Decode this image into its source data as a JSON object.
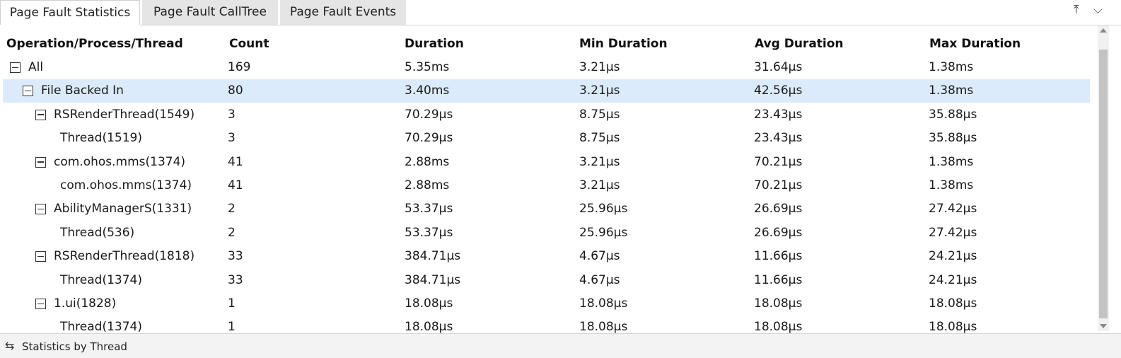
{
  "tabs": [
    {
      "label": "Page Fault Statistics",
      "active": true
    },
    {
      "label": "Page Fault CallTree",
      "active": false
    },
    {
      "label": "Page Fault Events",
      "active": false
    }
  ],
  "window_controls": {
    "pin_icon": "⤒",
    "collapse_icon": "⌵"
  },
  "columns": [
    "Operation/Process/Thread",
    "Count",
    "Duration",
    "Min Duration",
    "Avg Duration",
    "Max Duration"
  ],
  "rows": [
    {
      "name": "All",
      "level": 0,
      "expandable": true,
      "selected": false,
      "count": "169",
      "duration": "5.35ms",
      "min": "3.21μs",
      "avg": "31.64μs",
      "max": "1.38ms"
    },
    {
      "name": "File Backed In",
      "level": 1,
      "expandable": true,
      "selected": true,
      "count": "80",
      "duration": "3.40ms",
      "min": "3.21μs",
      "avg": "42.56μs",
      "max": "1.38ms"
    },
    {
      "name": "RSRenderThread(1549)",
      "level": 2,
      "expandable": true,
      "selected": false,
      "count": "3",
      "duration": "70.29μs",
      "min": "8.75μs",
      "avg": "23.43μs",
      "max": "35.88μs"
    },
    {
      "name": "Thread(1519)",
      "level": 3,
      "expandable": false,
      "selected": false,
      "count": "3",
      "duration": "70.29μs",
      "min": "8.75μs",
      "avg": "23.43μs",
      "max": "35.88μs"
    },
    {
      "name": "com.ohos.mms(1374)",
      "level": 2,
      "expandable": true,
      "selected": false,
      "count": "41",
      "duration": "2.88ms",
      "min": "3.21μs",
      "avg": "70.21μs",
      "max": "1.38ms"
    },
    {
      "name": "com.ohos.mms(1374)",
      "level": 3,
      "expandable": false,
      "selected": false,
      "count": "41",
      "duration": "2.88ms",
      "min": "3.21μs",
      "avg": "70.21μs",
      "max": "1.38ms"
    },
    {
      "name": "AbilityManagerS(1331)",
      "level": 2,
      "expandable": true,
      "selected": false,
      "count": "2",
      "duration": "53.37μs",
      "min": "25.96μs",
      "avg": "26.69μs",
      "max": "27.42μs"
    },
    {
      "name": "Thread(536)",
      "level": 3,
      "expandable": false,
      "selected": false,
      "count": "2",
      "duration": "53.37μs",
      "min": "25.96μs",
      "avg": "26.69μs",
      "max": "27.42μs"
    },
    {
      "name": "RSRenderThread(1818)",
      "level": 2,
      "expandable": true,
      "selected": false,
      "count": "33",
      "duration": "384.71μs",
      "min": "4.67μs",
      "avg": "11.66μs",
      "max": "24.21μs"
    },
    {
      "name": "Thread(1374)",
      "level": 3,
      "expandable": false,
      "selected": false,
      "count": "33",
      "duration": "384.71μs",
      "min": "4.67μs",
      "avg": "11.66μs",
      "max": "24.21μs"
    },
    {
      "name": "1.ui(1828)",
      "level": 2,
      "expandable": true,
      "selected": false,
      "count": "1",
      "duration": "18.08μs",
      "min": "18.08μs",
      "avg": "18.08μs",
      "max": "18.08μs"
    },
    {
      "name": "Thread(1374)",
      "level": 3,
      "expandable": false,
      "selected": false,
      "count": "1",
      "duration": "18.08μs",
      "min": "18.08μs",
      "avg": "18.08μs",
      "max": "18.08μs"
    }
  ],
  "status": {
    "icon": "swap-icon",
    "glyph": "⇆",
    "label": "Statistics by Thread"
  }
}
